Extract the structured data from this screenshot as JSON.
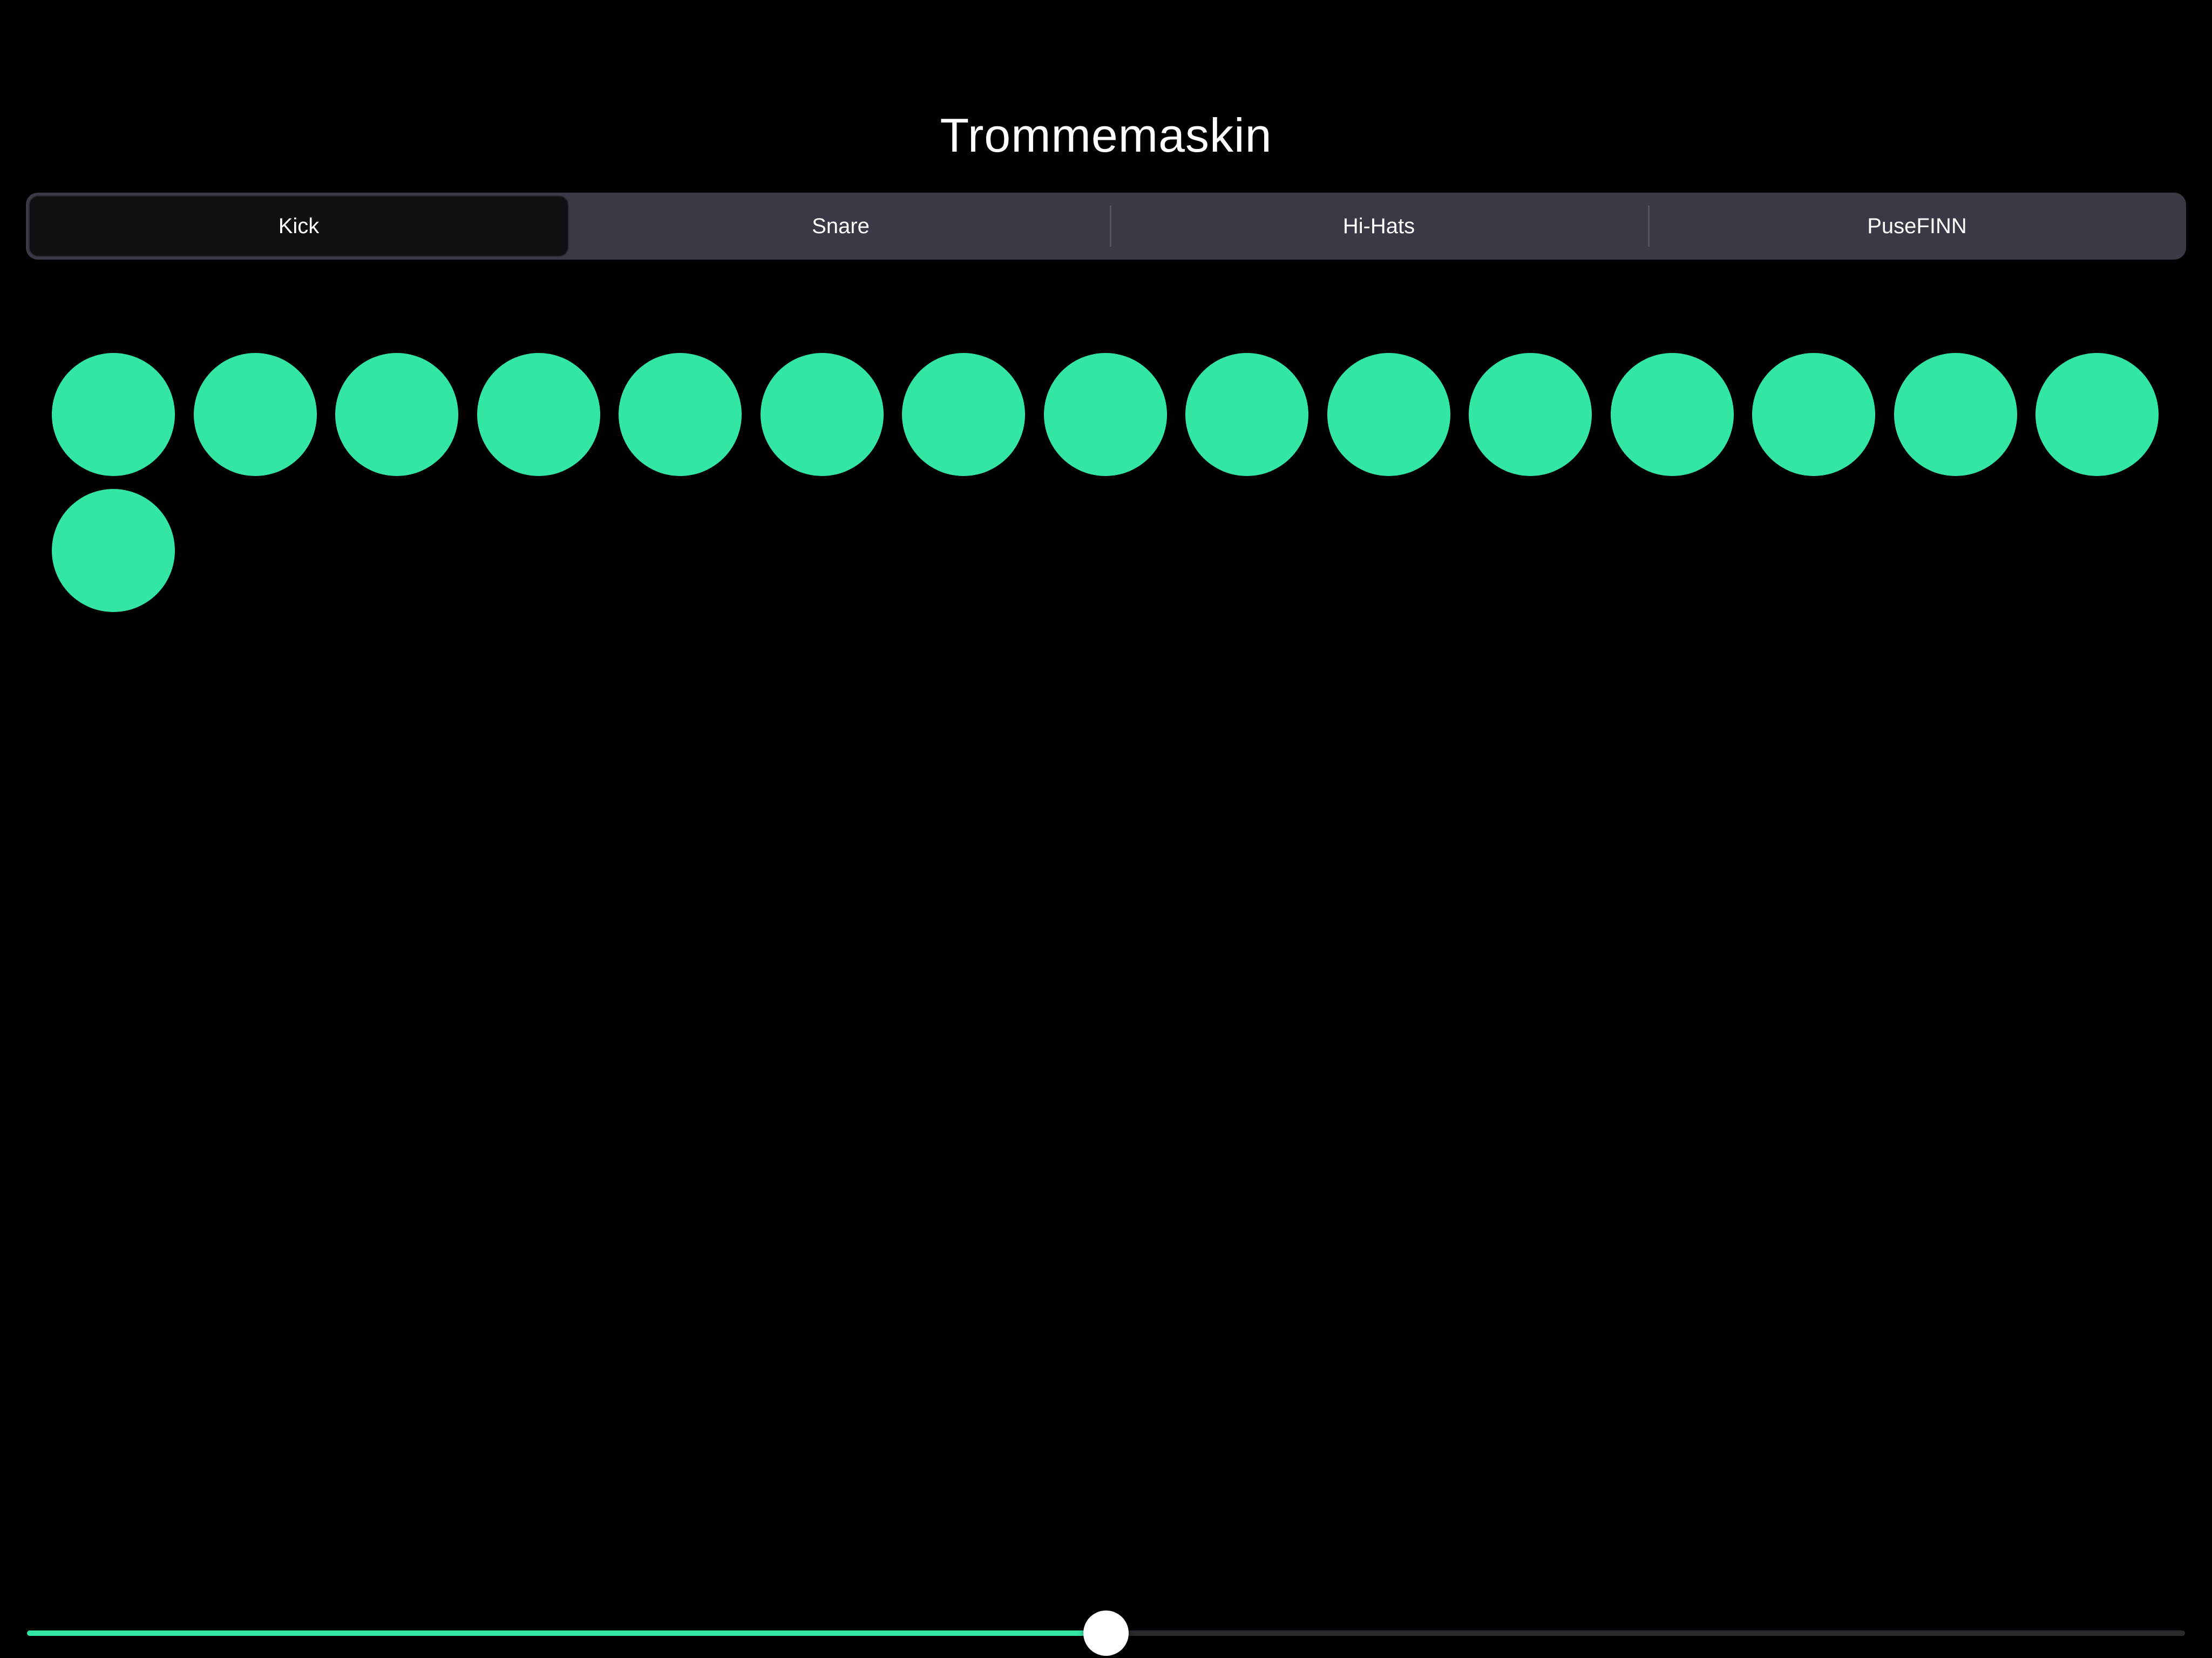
{
  "app": {
    "title": "Trommemaskin"
  },
  "tabs": [
    {
      "label": "Kick",
      "selected": true
    },
    {
      "label": "Snare",
      "selected": false
    },
    {
      "label": "Hi-Hats",
      "selected": false
    },
    {
      "label": "PuseFINN",
      "selected": false
    }
  ],
  "pads": {
    "count": 16,
    "color": "#33e6a4"
  },
  "slider": {
    "value": 0.5,
    "fill_color": "#33e6a4",
    "track_color": "#2a2a2e",
    "thumb_color": "#ffffff"
  },
  "colors": {
    "background": "#000000",
    "segment_background": "#3a3a47",
    "segment_selected": "#101014"
  }
}
